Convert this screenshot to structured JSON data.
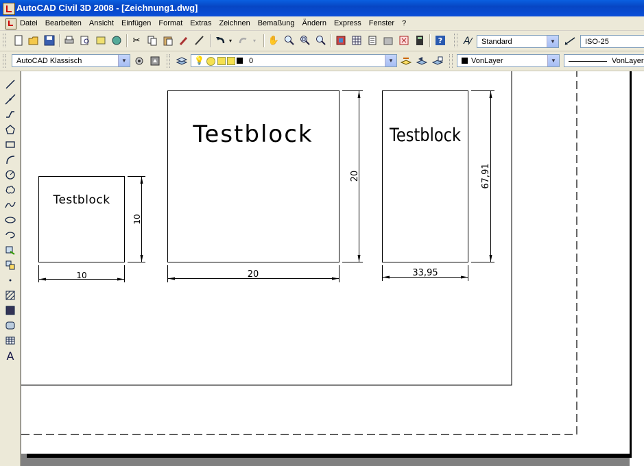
{
  "window": {
    "title": "AutoCAD Civil 3D 2008 - [Zeichnung1.dwg]"
  },
  "menu": [
    "Datei",
    "Bearbeiten",
    "Ansicht",
    "Einfügen",
    "Format",
    "Extras",
    "Zeichnen",
    "Bemaßung",
    "Ändern",
    "Express",
    "Fenster",
    "?"
  ],
  "toolbar1": {
    "icons": [
      "new-icon",
      "open-icon",
      "save-icon",
      "print-icon",
      "plot-preview-icon",
      "publish-icon",
      "3d-dwf-icon",
      "cut-icon",
      "copy-icon",
      "paste-icon",
      "match-properties-icon",
      "block-editor-icon",
      "undo-icon",
      "redo-icon",
      "pan-icon",
      "zoom-realtime-icon",
      "zoom-window-icon",
      "zoom-previous-icon",
      "properties-icon",
      "design-center-icon",
      "tool-palettes-icon",
      "sheet-set-icon",
      "markup-icon",
      "calculator-icon",
      "help-icon"
    ],
    "text_style": "Standard",
    "dim_style": "ISO-25"
  },
  "toolbar2": {
    "workspace": "AutoCAD Klassisch",
    "layer": "0",
    "color": "VonLayer",
    "linetype": "VonLayer"
  },
  "draw_tools": [
    "line-icon",
    "construction-line-icon",
    "polyline-icon",
    "polygon-icon",
    "rectangle-icon",
    "arc-icon",
    "circle-icon",
    "revision-cloud-icon",
    "spline-icon",
    "ellipse-icon",
    "ellipse-arc-icon",
    "insert-block-icon",
    "make-block-icon",
    "point-icon",
    "hatch-icon",
    "gradient-icon",
    "region-icon",
    "table-icon",
    "multiline-text-icon"
  ],
  "drawing": {
    "blocks": [
      {
        "label": "Testblock",
        "width_dim": "10",
        "height_dim": "10"
      },
      {
        "label": "Testblock",
        "width_dim": "20",
        "height_dim": "20"
      },
      {
        "label": "Testblock",
        "width_dim": "33,95",
        "height_dim": "67,91"
      }
    ]
  }
}
